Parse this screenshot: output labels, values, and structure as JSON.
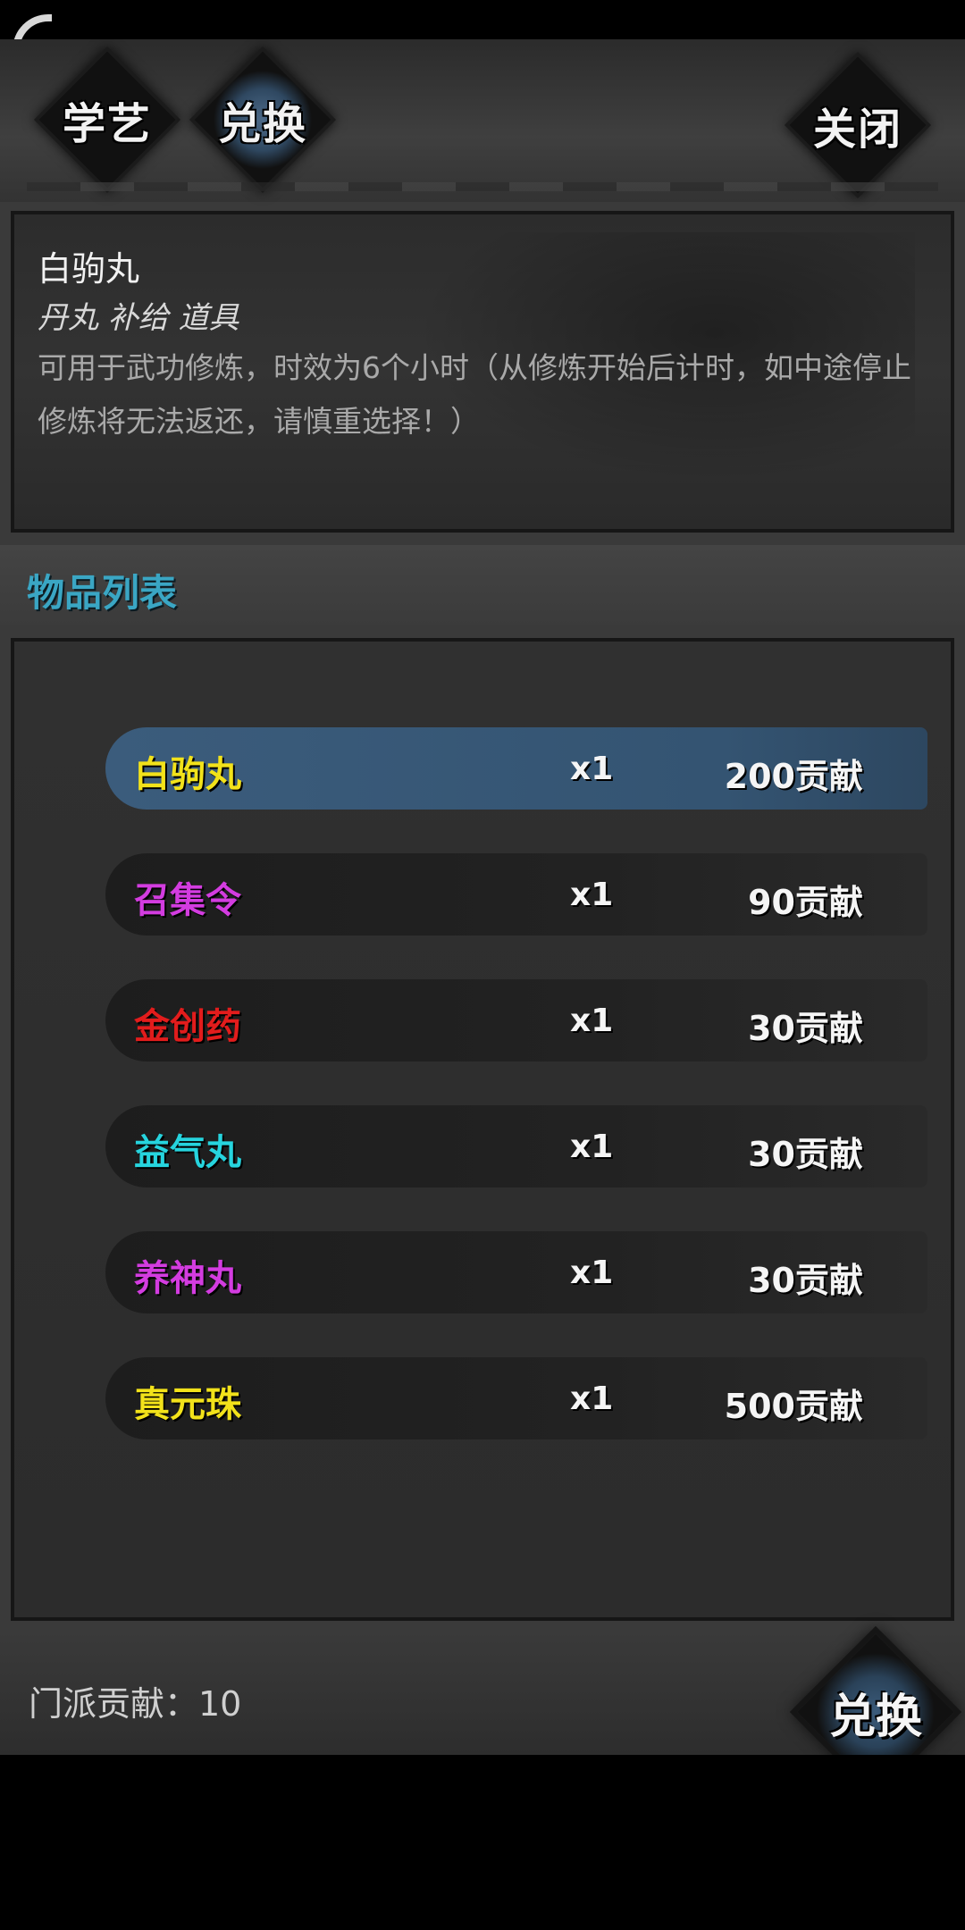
{
  "tabs": [
    {
      "label": "学艺",
      "active": false
    },
    {
      "label": "兑换",
      "active": true
    }
  ],
  "close_label": "关闭",
  "detail": {
    "name": "白驹丸",
    "tags": "丹丸 补给 道具",
    "description": "可用于武功修炼，时效为6个小时（从修炼开始后计时，如中途停止修炼将无法返还，请慎重选择！）"
  },
  "list_title": "物品列表",
  "items": [
    {
      "name": "白驹丸",
      "qty": "x1",
      "cost": "200贡献",
      "color": "#f2e21a",
      "selected": true
    },
    {
      "name": "召集令",
      "qty": "x1",
      "cost": "90贡献",
      "color": "#d33ce0",
      "selected": false
    },
    {
      "name": "金创药",
      "qty": "x1",
      "cost": "30贡献",
      "color": "#e21c1c",
      "selected": false
    },
    {
      "name": "益气丸",
      "qty": "x1",
      "cost": "30贡献",
      "color": "#26d4de",
      "selected": false
    },
    {
      "name": "养神丸",
      "qty": "x1",
      "cost": "30贡献",
      "color": "#d33ce0",
      "selected": false
    },
    {
      "name": "真元珠",
      "qty": "x1",
      "cost": "500贡献",
      "color": "#f2e21a",
      "selected": false
    }
  ],
  "footer": {
    "contribution_label": "门派贡献：10",
    "exchange_label": "兑换"
  }
}
